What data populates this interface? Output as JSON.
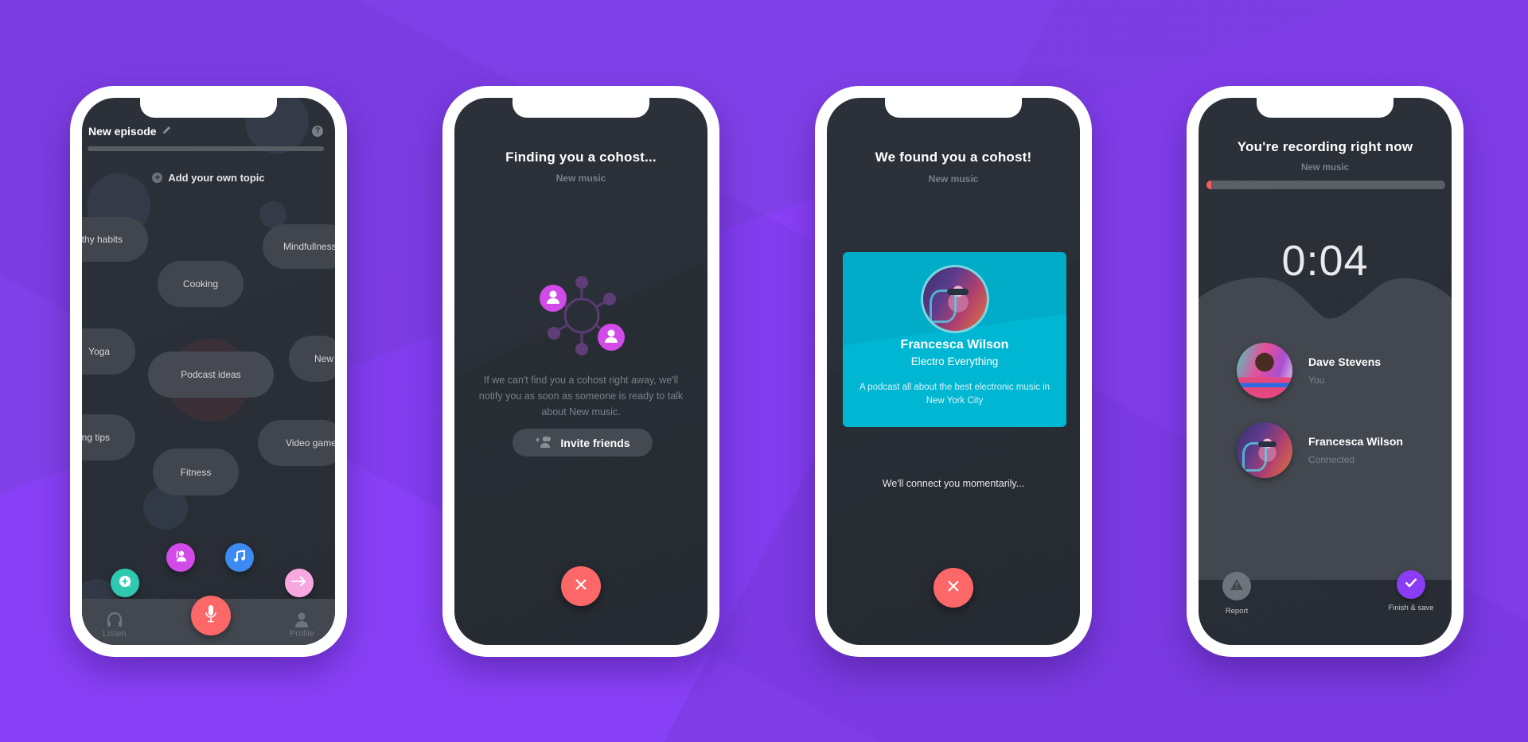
{
  "colors": {
    "background": "#8840f6",
    "screen": "#2a2f37",
    "accent_red": "#fc6767",
    "accent_magenta": "#d24ae8",
    "accent_blue": "#3d8bf2",
    "accent_teal": "#2ec9b0",
    "accent_pink": "#f7a8e0",
    "card_cyan": "#00b7d3",
    "finish_purple": "#8a3df5"
  },
  "screen1": {
    "header_title": "New episode",
    "edit_icon": "pencil-icon",
    "help_icon_label": "?",
    "add_topic_label": "Add your own topic",
    "topics": [
      {
        "label": "Healthy habits",
        "visible": "thy habits"
      },
      {
        "label": "Mindfulness",
        "visible": "Mindfullness"
      },
      {
        "label": "Cooking",
        "visible": "Cooking"
      },
      {
        "label": "Yoga",
        "visible": "Yoga"
      },
      {
        "label": "Podcast ideas",
        "visible": "Podcast ideas"
      },
      {
        "label": "New music",
        "visible": "New"
      },
      {
        "label": "Cooking tips",
        "visible": "ng tips"
      },
      {
        "label": "Video games",
        "visible": "Video game"
      },
      {
        "label": "Fitness",
        "visible": "Fitness"
      }
    ],
    "fab_buttons": [
      {
        "name": "add-comment",
        "icon": "chat-plus-icon"
      },
      {
        "name": "find-cohost",
        "icon": "people-icon"
      },
      {
        "name": "music",
        "icon": "music-note-icon"
      },
      {
        "name": "next",
        "icon": "arrow-right-icon"
      }
    ],
    "tabs": {
      "listen": "Listen",
      "record_icon": "microphone-icon",
      "profile": "Profile"
    }
  },
  "screen2": {
    "title": "Finding you a cohost...",
    "topic": "New music",
    "explanation": "If we can't find you a cohost right away, we'll notify you as soon as someone is ready to talk about New music.",
    "invite_label": "Invite friends",
    "cancel_icon": "close-icon"
  },
  "screen3": {
    "title": "We found you a cohost!",
    "topic": "New music",
    "cohost": {
      "name": "Francesca Wilson",
      "show": "Electro Everything",
      "description": "A podcast all about the best electronic music in  New York City"
    },
    "connect_message": "We'll connect you momentarily...",
    "cancel_icon": "close-icon"
  },
  "screen4": {
    "title": "You're recording right now",
    "topic": "New music",
    "progress": 0.02,
    "timer": "0:04",
    "participants": [
      {
        "name": "Dave Stevens",
        "status": "You"
      },
      {
        "name": "Francesca Wilson",
        "status": "Connected"
      }
    ],
    "report_label": "Report",
    "finish_label": "Finish & save"
  }
}
